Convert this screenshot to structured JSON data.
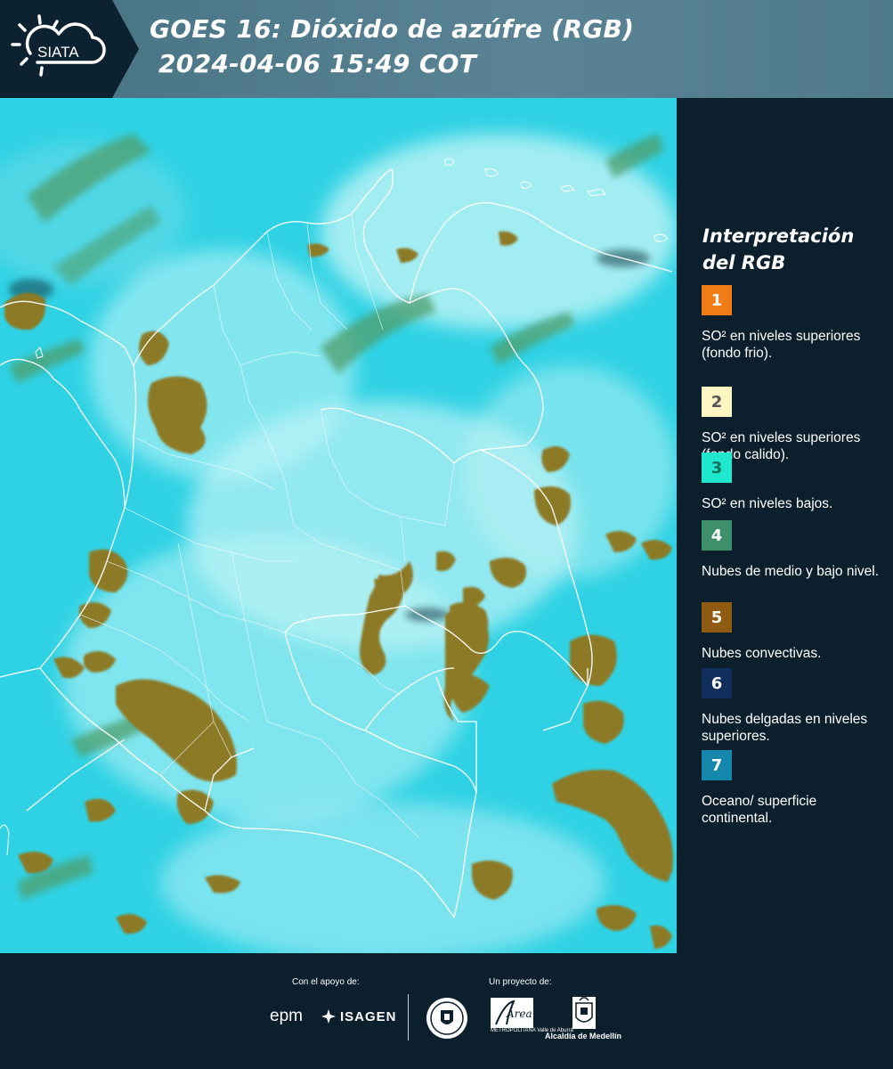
{
  "header": {
    "logo_text": "SIATA",
    "title_line1": "GOES 16: Dióxido de azúfre (RGB)",
    "title_line2": "2024-04-06 15:49 COT"
  },
  "legend": {
    "title": "Interpretación del RGB",
    "items": [
      {
        "number": "1",
        "color": "#f07c16",
        "text_color": "#ffffff",
        "label": "SO² en niveles superiores (fondo frio)."
      },
      {
        "number": "2",
        "color": "#fdf5c2",
        "text_color": "#555555",
        "label": "SO² en niveles superiores (fondo calido)."
      },
      {
        "number": "3",
        "color": "#1fe7cd",
        "text_color": "#13715f",
        "label": "SO² en niveles bajos."
      },
      {
        "number": "4",
        "color": "#3e8f6b",
        "text_color": "#ffffff",
        "label": "Nubes de medio y bajo nivel."
      },
      {
        "number": "5",
        "color": "#8f5a12",
        "text_color": "#ffffff",
        "label": "Nubes convectivas."
      },
      {
        "number": "6",
        "color": "#0f2e5c",
        "text_color": "#ffffff",
        "label": "Nubes delgadas en niveles superiores."
      },
      {
        "number": "7",
        "color": "#1587ad",
        "text_color": "#ffffff",
        "label": "Oceano/ superficie continental."
      }
    ]
  },
  "map": {
    "colors": {
      "background": "#2fd2e4",
      "haze": "#bdf3f6",
      "convective": "#8c7a28",
      "low_cloud": "#4f9e6c",
      "border": "#ffffff"
    }
  },
  "footer": {
    "support_label": "Con el apoyo de:",
    "project_label": "Un proyecto de:",
    "epm": "epm",
    "isagen": "ISAGEN",
    "area_name": "Área",
    "area_sub": "METROPOLITANA Valle de Aburrá",
    "alcaldia": "Alcaldía de Medellín"
  }
}
